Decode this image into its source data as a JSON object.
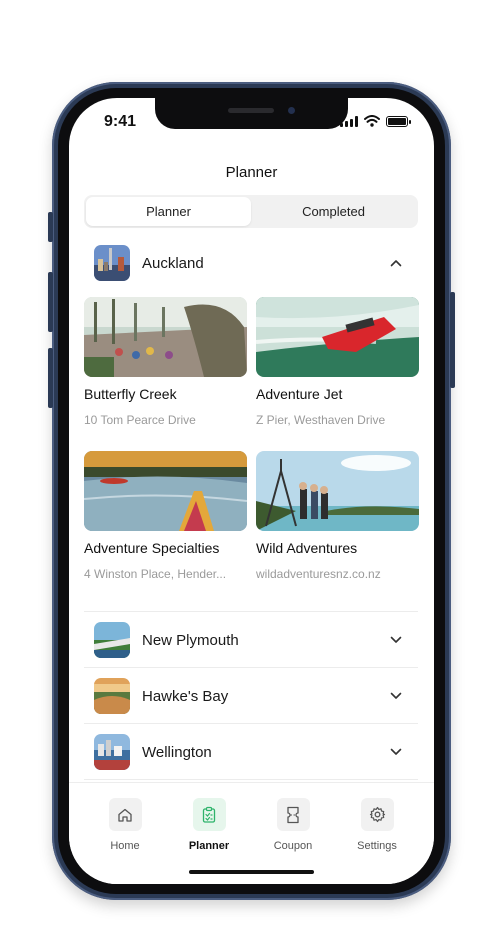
{
  "status_bar": {
    "time": "9:41",
    "icons": [
      "signal-icon",
      "wifi-icon",
      "battery-icon"
    ]
  },
  "header": {
    "title": "Planner"
  },
  "segment": {
    "tabs": [
      {
        "label": "Planner",
        "active": true
      },
      {
        "label": "Completed",
        "active": false
      }
    ]
  },
  "expanded_city": {
    "name": "Auckland",
    "thumb_icon": "auckland-city-photo",
    "chevron_icon": "chevron-up-icon",
    "places": [
      {
        "title": "Butterfly Creek",
        "subtitle": "10 Tom Pearce Drive",
        "photo": "butterfly-creek-photo"
      },
      {
        "title": "Adventure Jet",
        "subtitle": "Z Pier, Westhaven Drive",
        "photo": "jet-boat-photo"
      },
      {
        "title": "Adventure Specialties",
        "subtitle": "4 Winston Place, Hender...",
        "photo": "kayak-photo"
      },
      {
        "title": "Wild Adventures",
        "subtitle": "wildadventuresnz.co.nz",
        "photo": "hikers-photo"
      }
    ]
  },
  "collapsed_cities": [
    {
      "name": "New Plymouth",
      "thumb_icon": "new-plymouth-photo",
      "chevron_icon": "chevron-down-icon"
    },
    {
      "name": "Hawke's Bay",
      "thumb_icon": "hawkes-bay-photo",
      "chevron_icon": "chevron-down-icon"
    },
    {
      "name": "Wellington",
      "thumb_icon": "wellington-photo",
      "chevron_icon": "chevron-down-icon"
    }
  ],
  "tab_bar": {
    "items": [
      {
        "label": "Home",
        "icon": "home-icon",
        "active": false
      },
      {
        "label": "Planner",
        "icon": "planner-icon",
        "active": true
      },
      {
        "label": "Coupon",
        "icon": "coupon-icon",
        "active": false
      },
      {
        "label": "Settings",
        "icon": "gear-icon",
        "active": false
      }
    ]
  },
  "colors": {
    "accent": "#2fb36b",
    "phone_frame": "#2b3a55",
    "muted_text": "#9a9a9a"
  }
}
